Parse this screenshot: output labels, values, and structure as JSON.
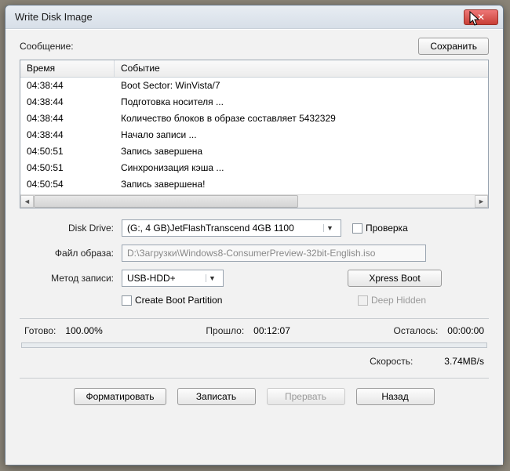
{
  "window": {
    "title": "Write Disk Image"
  },
  "topbar": {
    "message_label": "Сообщение:",
    "save_label": "Сохранить"
  },
  "log": {
    "headers": {
      "time": "Время",
      "event": "Событие"
    },
    "rows": [
      {
        "time": "04:38:44",
        "event": "Boot Sector: WinVista/7"
      },
      {
        "time": "04:38:44",
        "event": "Подготовка носителя ..."
      },
      {
        "time": "04:38:44",
        "event": "Количество блоков в образе составляет 5432329"
      },
      {
        "time": "04:38:44",
        "event": "Начало записи ..."
      },
      {
        "time": "04:50:51",
        "event": "Запись завершена"
      },
      {
        "time": "04:50:51",
        "event": "Синхронизация кэша ..."
      },
      {
        "time": "04:50:54",
        "event": "Запись завершена!"
      }
    ]
  },
  "form": {
    "disk_drive_label": "Disk Drive:",
    "disk_drive_value": "(G:, 4 GB)JetFlashTranscend 4GB  1100",
    "verify_label": "Проверка",
    "image_file_label": "Файл образа:",
    "image_file_value": "D:\\Загрузки\\Windows8-ConsumerPreview-32bit-English.iso",
    "write_method_label": "Метод записи:",
    "write_method_value": "USB-HDD+",
    "xpress_boot_label": "Xpress Boot",
    "create_boot_partition_label": "Create Boot Partition",
    "deep_hidden_label": "Deep Hidden"
  },
  "status": {
    "done_label": "Готово:",
    "done_value": "100.00%",
    "elapsed_label": "Прошло:",
    "elapsed_value": "00:12:07",
    "remain_label": "Осталось:",
    "remain_value": "00:00:00",
    "speed_label": "Скорость:",
    "speed_value": "3.74MB/s"
  },
  "buttons": {
    "format": "Форматировать",
    "write": "Записать",
    "abort": "Прервать",
    "back": "Назад"
  }
}
